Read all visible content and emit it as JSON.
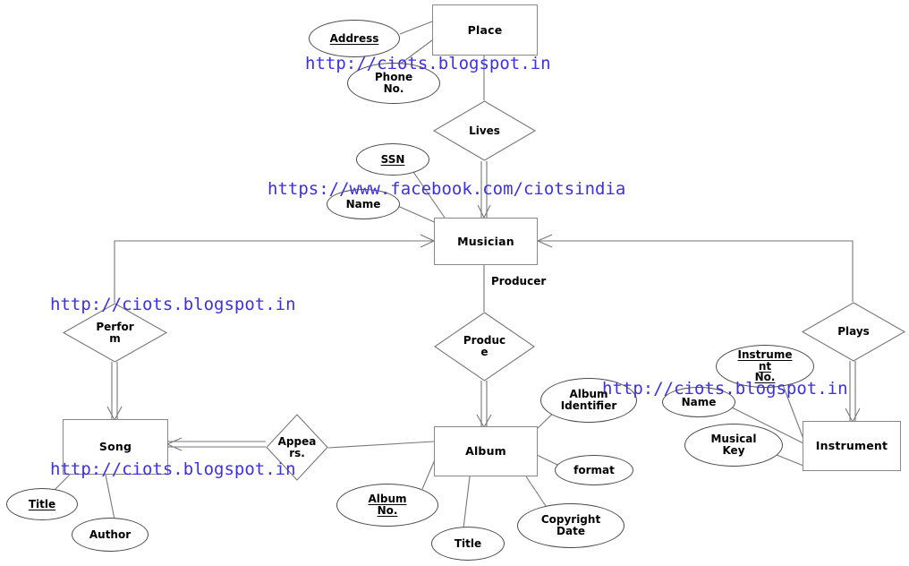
{
  "diagram": {
    "title": "Music Database ER Diagram",
    "stroke_color": "#555555",
    "attr_stroke_color": "#4a4a4a",
    "watermark_color": "#3b30e8",
    "background": "#ffffff"
  },
  "entities": [
    {
      "id": "place",
      "label": "Place"
    },
    {
      "id": "musician",
      "label": "Musician"
    },
    {
      "id": "song",
      "label": "Song"
    },
    {
      "id": "album",
      "label": "Album"
    },
    {
      "id": "instrument",
      "label": "Instrument"
    }
  ],
  "relationships": [
    {
      "id": "lives",
      "label": "Lives"
    },
    {
      "id": "perform",
      "label": "Perfor m"
    },
    {
      "id": "produce",
      "label": "Produc e"
    },
    {
      "id": "appears",
      "label": "Appea rs."
    },
    {
      "id": "plays",
      "label": "Plays"
    }
  ],
  "attributes": [
    {
      "id": "address",
      "label": "Address",
      "owner": "place",
      "key": true
    },
    {
      "id": "phone-no",
      "label": "Phone No.",
      "owner": "place",
      "key": false
    },
    {
      "id": "ssn",
      "label": "SSN",
      "owner": "musician",
      "key": true
    },
    {
      "id": "musician-name",
      "label": "Name",
      "owner": "musician",
      "key": false
    },
    {
      "id": "song-title",
      "label": "Title",
      "owner": "song",
      "key": true
    },
    {
      "id": "song-author",
      "label": "Author",
      "owner": "song",
      "key": false
    },
    {
      "id": "album-identifier",
      "label": "Album Identifier",
      "owner": "album",
      "key": false
    },
    {
      "id": "album-format",
      "label": "format",
      "owner": "album",
      "key": false
    },
    {
      "id": "album-no",
      "label": "Album No.",
      "owner": "album",
      "key": true
    },
    {
      "id": "album-title",
      "label": "Title",
      "owner": "album",
      "key": false
    },
    {
      "id": "copyright-date",
      "label": "Copyright Date",
      "owner": "album",
      "key": false
    },
    {
      "id": "instrument-no",
      "label": "Instrume nt No.",
      "owner": "instrument",
      "key": true
    },
    {
      "id": "instrument-name",
      "label": "Name",
      "owner": "instrument",
      "key": false
    },
    {
      "id": "musical-key",
      "label": "Musical Key",
      "owner": "instrument",
      "key": false
    }
  ],
  "edge_labels": [
    {
      "id": "producer-role",
      "label": "Producer"
    }
  ],
  "watermarks": [
    {
      "id": "wm-1",
      "text": "http://ciots.blogspot.in"
    },
    {
      "id": "wm-2",
      "text": "https://www.facebook.com/ciotsindia"
    },
    {
      "id": "wm-3",
      "text": "http://ciots.blogspot.in"
    },
    {
      "id": "wm-4",
      "text": "http://ciots.blogspot.in"
    },
    {
      "id": "wm-5",
      "text": "http://ciots.blogspot.in"
    }
  ]
}
